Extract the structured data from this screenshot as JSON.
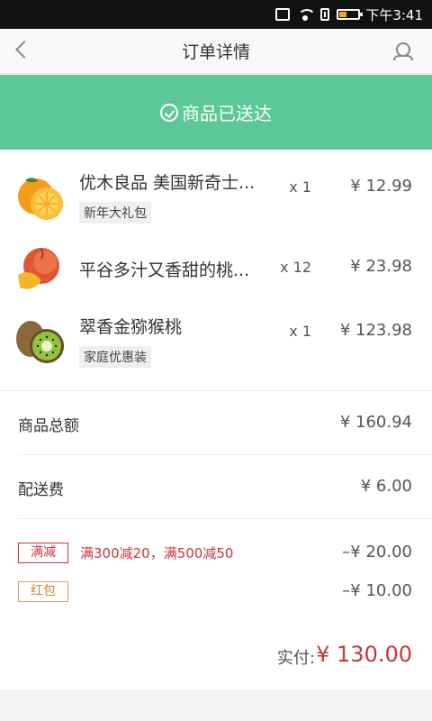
{
  "status_bar": {
    "time": "下午3:41"
  },
  "navbar": {
    "title": "订单详情"
  },
  "banner": {
    "text": "商品已送达"
  },
  "items": [
    {
      "name": "优木良品 美国新奇士...",
      "tag": "新年大礼包",
      "qty": "x 1",
      "price": "¥  12.99",
      "image": "orange"
    },
    {
      "name": "平谷多汁又香甜的桃...",
      "tag": "",
      "qty": "x 12",
      "price": "¥  23.98",
      "image": "peach"
    },
    {
      "name": "翠香金猕猴桃",
      "tag": "家庭优惠装",
      "qty": "x 1",
      "price": "¥  123.98",
      "image": "kiwi"
    }
  ],
  "summary": {
    "goods_total_label": "商品总额",
    "goods_total_value": "¥  160.94",
    "shipping_label": "配送费",
    "shipping_value": "¥  6.00",
    "discounts": [
      {
        "badge": "满减",
        "desc": "满300减20，满500减50",
        "value": "–¥  20.00",
        "color": "#c9353b"
      },
      {
        "badge": "红包",
        "desc": "",
        "value": "–¥  10.00",
        "color": "#d3a35b"
      }
    ]
  },
  "total": {
    "label": "实付:",
    "value": "¥  130.00"
  },
  "colors": {
    "banner_green": "#5cc797",
    "accent_red": "#c9353b",
    "gold": "#d3a35b"
  }
}
